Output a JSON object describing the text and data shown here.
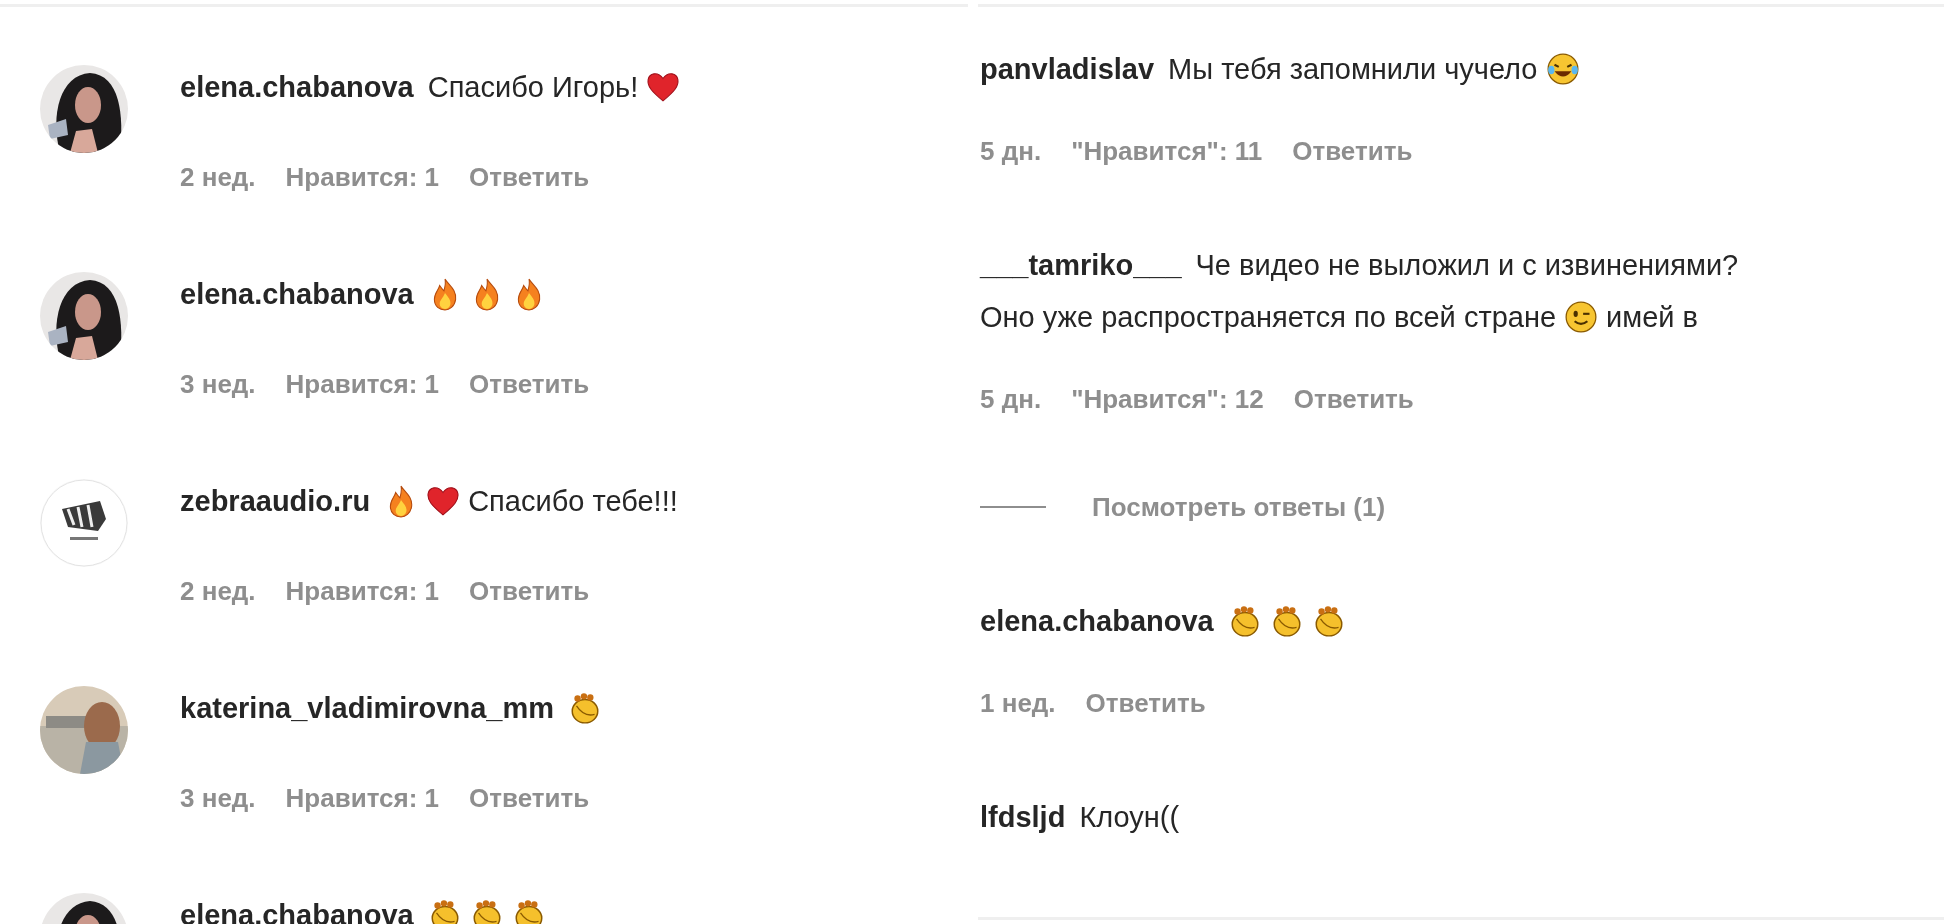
{
  "left_panel": {
    "comments": [
      {
        "username": "elena.chabanova",
        "lines": [
          [
            {
              "kind": "text",
              "text": "Спасибо Игорь!"
            },
            {
              "kind": "heart"
            }
          ]
        ],
        "time": "2 нед.",
        "likes": "Нравится: 1",
        "reply": "Ответить"
      },
      {
        "username": "elena.chabanova",
        "lines": [
          [
            {
              "kind": "fire"
            },
            {
              "kind": "fire"
            },
            {
              "kind": "fire"
            }
          ]
        ],
        "time": "3 нед.",
        "likes": "Нравится: 1",
        "reply": "Ответить"
      },
      {
        "username": "zebraaudio.ru",
        "lines": [
          [
            {
              "kind": "fire"
            },
            {
              "kind": "heart"
            },
            {
              "kind": "text",
              "text": "Спасибо тебе!!!"
            }
          ]
        ],
        "time": "2 нед.",
        "likes": "Нравится: 1",
        "reply": "Ответить"
      },
      {
        "username": "katerina_vladimirovna_mm",
        "lines": [
          [
            {
              "kind": "clap"
            }
          ]
        ],
        "time": "3 нед.",
        "likes": "Нравится: 1",
        "reply": "Ответить"
      },
      {
        "username": "elena.chabanova",
        "lines": [
          [
            {
              "kind": "clap"
            },
            {
              "kind": "clap"
            },
            {
              "kind": "clap"
            }
          ]
        ]
      }
    ]
  },
  "right_panel": {
    "items": [
      {
        "kind": "comment",
        "username": "panvladislav",
        "lines": [
          [
            {
              "kind": "text",
              "text": "Мы тебя запомнили чучело"
            },
            {
              "kind": "laugh"
            }
          ]
        ],
        "time": "5 дн.",
        "likes": "\"Нравится\": 11",
        "reply": "Ответить"
      },
      {
        "kind": "comment",
        "username": "___tamriko___",
        "lines": [
          [
            {
              "kind": "text",
              "text": "Че видео не выложил и с извинениями?"
            }
          ],
          [
            {
              "kind": "text",
              "text": "Оно уже распространяется по всей стране"
            },
            {
              "kind": "wink"
            },
            {
              "kind": "text",
              "text": "имей в"
            }
          ]
        ],
        "time": "5 дн.",
        "likes": "\"Нравится\": 12",
        "reply": "Ответить"
      },
      {
        "kind": "replies",
        "label": "Посмотреть ответы (1)"
      },
      {
        "kind": "comment",
        "username": "elena.chabanova",
        "lines": [
          [
            {
              "kind": "clap"
            },
            {
              "kind": "clap"
            },
            {
              "kind": "clap"
            }
          ]
        ],
        "time": "1 нед.",
        "reply": "Ответить"
      },
      {
        "kind": "comment",
        "username": "lfdsljd",
        "lines": [
          [
            {
              "kind": "text",
              "text": "Клоун(("
            }
          ]
        ]
      }
    ]
  }
}
